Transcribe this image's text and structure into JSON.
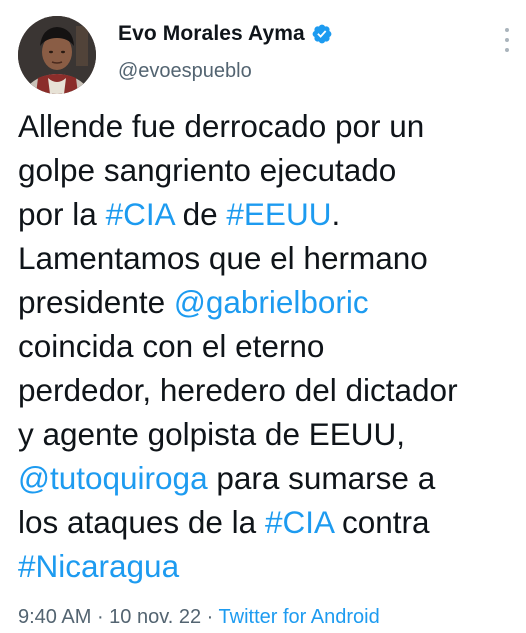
{
  "author": {
    "display_name": "Evo Morales Ayma",
    "handle": "@evoespueblo",
    "verified": true,
    "verified_color": "#1d9bf0"
  },
  "tweet": {
    "segments": [
      {
        "text": "Allende fue derrocado por un\ngolpe sangriento ejecutado\npor la ",
        "link": false
      },
      {
        "text": "#CIA",
        "link": true
      },
      {
        "text": " de ",
        "link": false
      },
      {
        "text": "#EEUU",
        "link": true
      },
      {
        "text": ".\nLamentamos que el hermano\npresidente ",
        "link": false
      },
      {
        "text": "@gabrielboric",
        "link": true
      },
      {
        "text": "\ncoincida con el eterno\nperdedor, heredero del dictador\ny agente golpista de EEUU,\n",
        "link": false
      },
      {
        "text": "@tutoquiroga",
        "link": true
      },
      {
        "text": " para sumarse a\nlos ataques de la ",
        "link": false
      },
      {
        "text": "#CIA",
        "link": true
      },
      {
        "text": " contra\n",
        "link": false
      },
      {
        "text": "#Nicaragua",
        "link": true
      }
    ]
  },
  "meta": {
    "time": "9:40 AM",
    "separator1": " · ",
    "date": "10 nov. 22",
    "separator2": " · ",
    "source": "Twitter for Android"
  },
  "icons": {
    "verified": "verified-badge-icon",
    "more": "more-options-icon",
    "avatar": "profile-avatar"
  },
  "colors": {
    "link": "#1d9bf0",
    "text": "#0f1419",
    "secondary": "#536471"
  }
}
